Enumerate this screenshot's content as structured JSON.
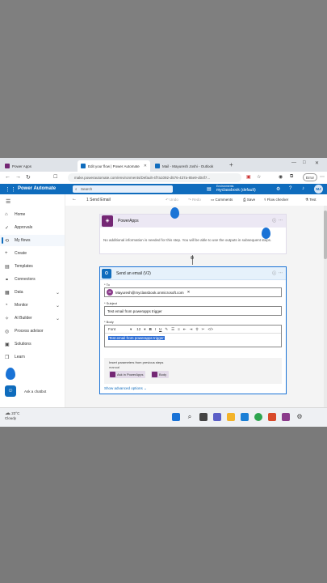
{
  "tabs": [
    {
      "label": "Power Apps",
      "active": false,
      "color": "#742774"
    },
    {
      "label": "Edit your flow | Power Automate",
      "active": true,
      "color": "#0f6cbd"
    },
    {
      "label": "Mail - Mayuresh Joshi - Outlook",
      "active": false,
      "color": "#0f6cbd"
    }
  ],
  "address": {
    "url": "make.powerautomate.com/environments/Default-4f7a1092-d576-437a-85e9-d04f7...",
    "error_label": "Error"
  },
  "header": {
    "brand": "Power Automate",
    "search_placeholder": "Search",
    "environment_label": "Environments",
    "environment_name": "myclassbook (default)",
    "avatar": "MJ"
  },
  "sidebar": {
    "items": [
      {
        "label": "Home",
        "icon": "home-icon",
        "glyph": "⌂"
      },
      {
        "label": "Approvals",
        "icon": "approvals-icon",
        "glyph": "✓"
      },
      {
        "label": "My flows",
        "icon": "flows-icon",
        "glyph": "⟲"
      },
      {
        "label": "Create",
        "icon": "create-icon",
        "glyph": "+"
      },
      {
        "label": "Templates",
        "icon": "templates-icon",
        "glyph": "▤"
      },
      {
        "label": "Connectors",
        "icon": "connectors-icon",
        "glyph": "⚭"
      },
      {
        "label": "Data",
        "icon": "data-icon",
        "glyph": "▦"
      },
      {
        "label": "Monitor",
        "icon": "monitor-icon",
        "glyph": "◔"
      },
      {
        "label": "AI Builder",
        "icon": "ai-builder-icon",
        "glyph": "✧"
      },
      {
        "label": "Process advisor",
        "icon": "process-advisor-icon",
        "glyph": "◎"
      },
      {
        "label": "Solutions",
        "icon": "solutions-icon",
        "glyph": "▣"
      },
      {
        "label": "Learn",
        "icon": "learn-icon",
        "glyph": "❐"
      }
    ],
    "chatbot_label": "Ask a chatbot"
  },
  "command_bar": {
    "flow_name": "1 Send Email",
    "undo": "Undo",
    "redo": "Redo",
    "comments": "Comments",
    "save": "Save",
    "flow_checker": "Flow checker",
    "test": "Test"
  },
  "trigger_card": {
    "title": "PowerApps",
    "message": "No additional information is needed for this step. You will be able to use the outputs in subsequent steps."
  },
  "action_card": {
    "title": "Send an email (V2)",
    "to_label": "* To",
    "to_value": "Mayuresh@myclassbook.onmicrosoft.com",
    "to_initial": "M",
    "subject_label": "* Subject",
    "subject_value": "Test email from powerapps trigger",
    "body_label": "* Body",
    "font_label": "Font",
    "font_size": "12",
    "body_value": "Test email from powerapps trigger",
    "dynamic_title": "Insert parameters from previous steps",
    "dynamic_group": "manual",
    "chip_ask": "Ask in PowerApps",
    "chip_body": "Body",
    "show_advanced": "Show advanced options"
  },
  "taskbar": {
    "temp": "23°C",
    "condition": "Cloudy"
  }
}
